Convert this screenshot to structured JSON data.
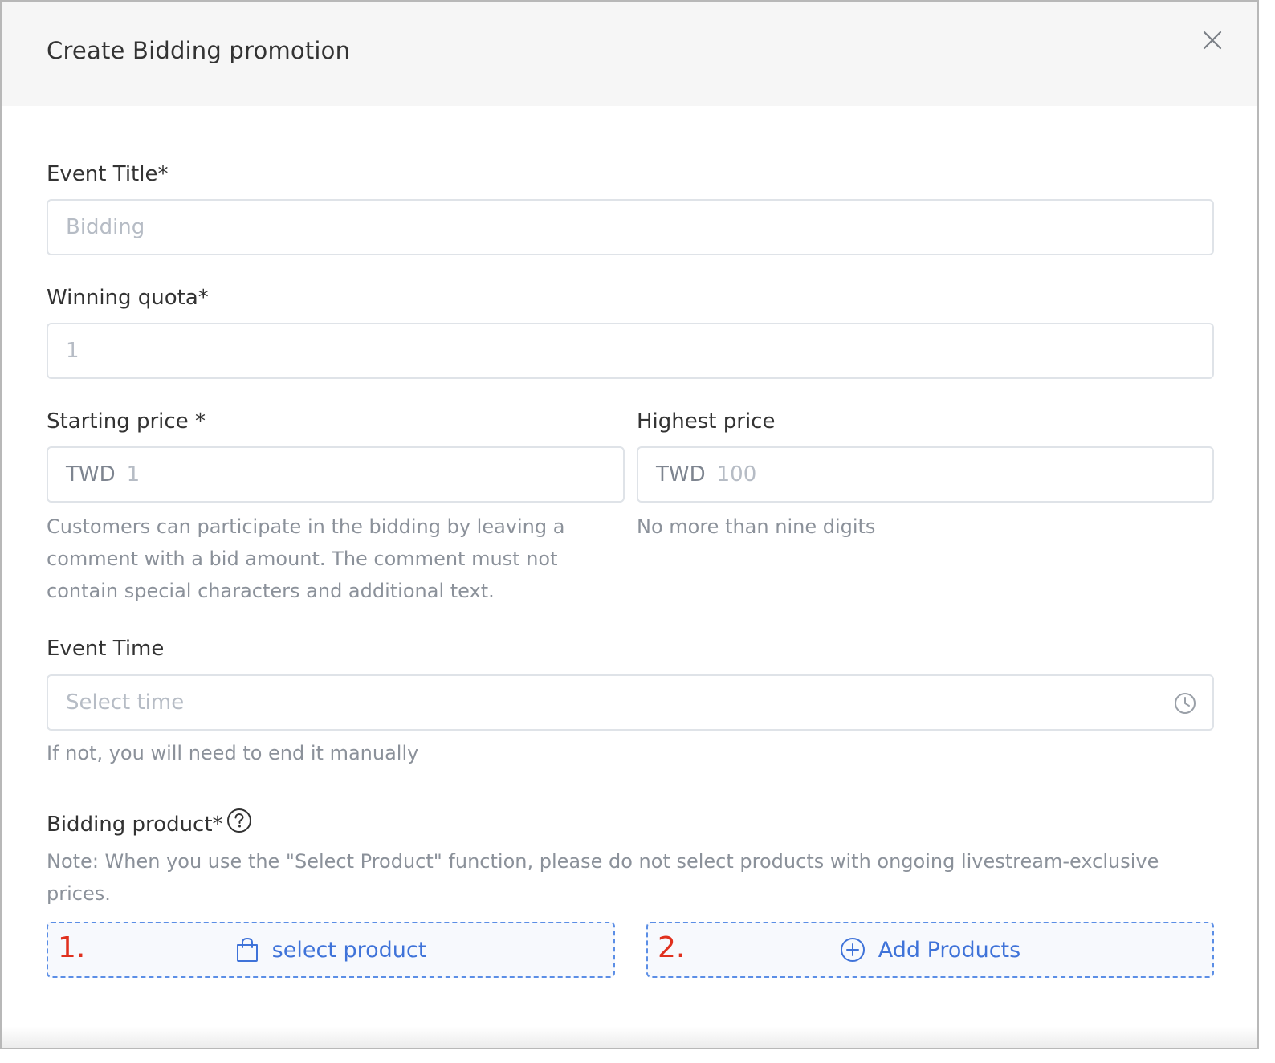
{
  "dialog": {
    "title": "Create Bidding promotion"
  },
  "fields": {
    "event_title": {
      "label": "Event Title*",
      "placeholder": "Bidding"
    },
    "winning_quota": {
      "label": "Winning quota*",
      "placeholder": "1"
    },
    "starting_price": {
      "label": "Starting price *",
      "prefix": "TWD",
      "placeholder": "1",
      "hint_lines": [
        "Customers can participate in the bidding by leaving a",
        "comment with a bid amount. The comment must not",
        "contain special characters and additional text."
      ]
    },
    "highest_price": {
      "label": "Highest price",
      "prefix": "TWD",
      "placeholder": "100",
      "hint": "No more than nine digits"
    },
    "event_time": {
      "label": "Event Time",
      "placeholder": "Select time",
      "hint": "If not, you will need to end it manually"
    },
    "bidding_product": {
      "label": "Bidding product*",
      "note_lines": [
        "Note: When you use the \"Select Product\" function, please do not select products with ongoing livestream-exclusive",
        "prices."
      ]
    }
  },
  "buttons": {
    "select_product": {
      "number": "1.",
      "label": "select product"
    },
    "add_products": {
      "number": "2.",
      "label": "Add Products"
    }
  },
  "colors": {
    "accent": "#3f73d9",
    "number_red": "#e0301e",
    "header_bg": "#f6f6f6"
  }
}
